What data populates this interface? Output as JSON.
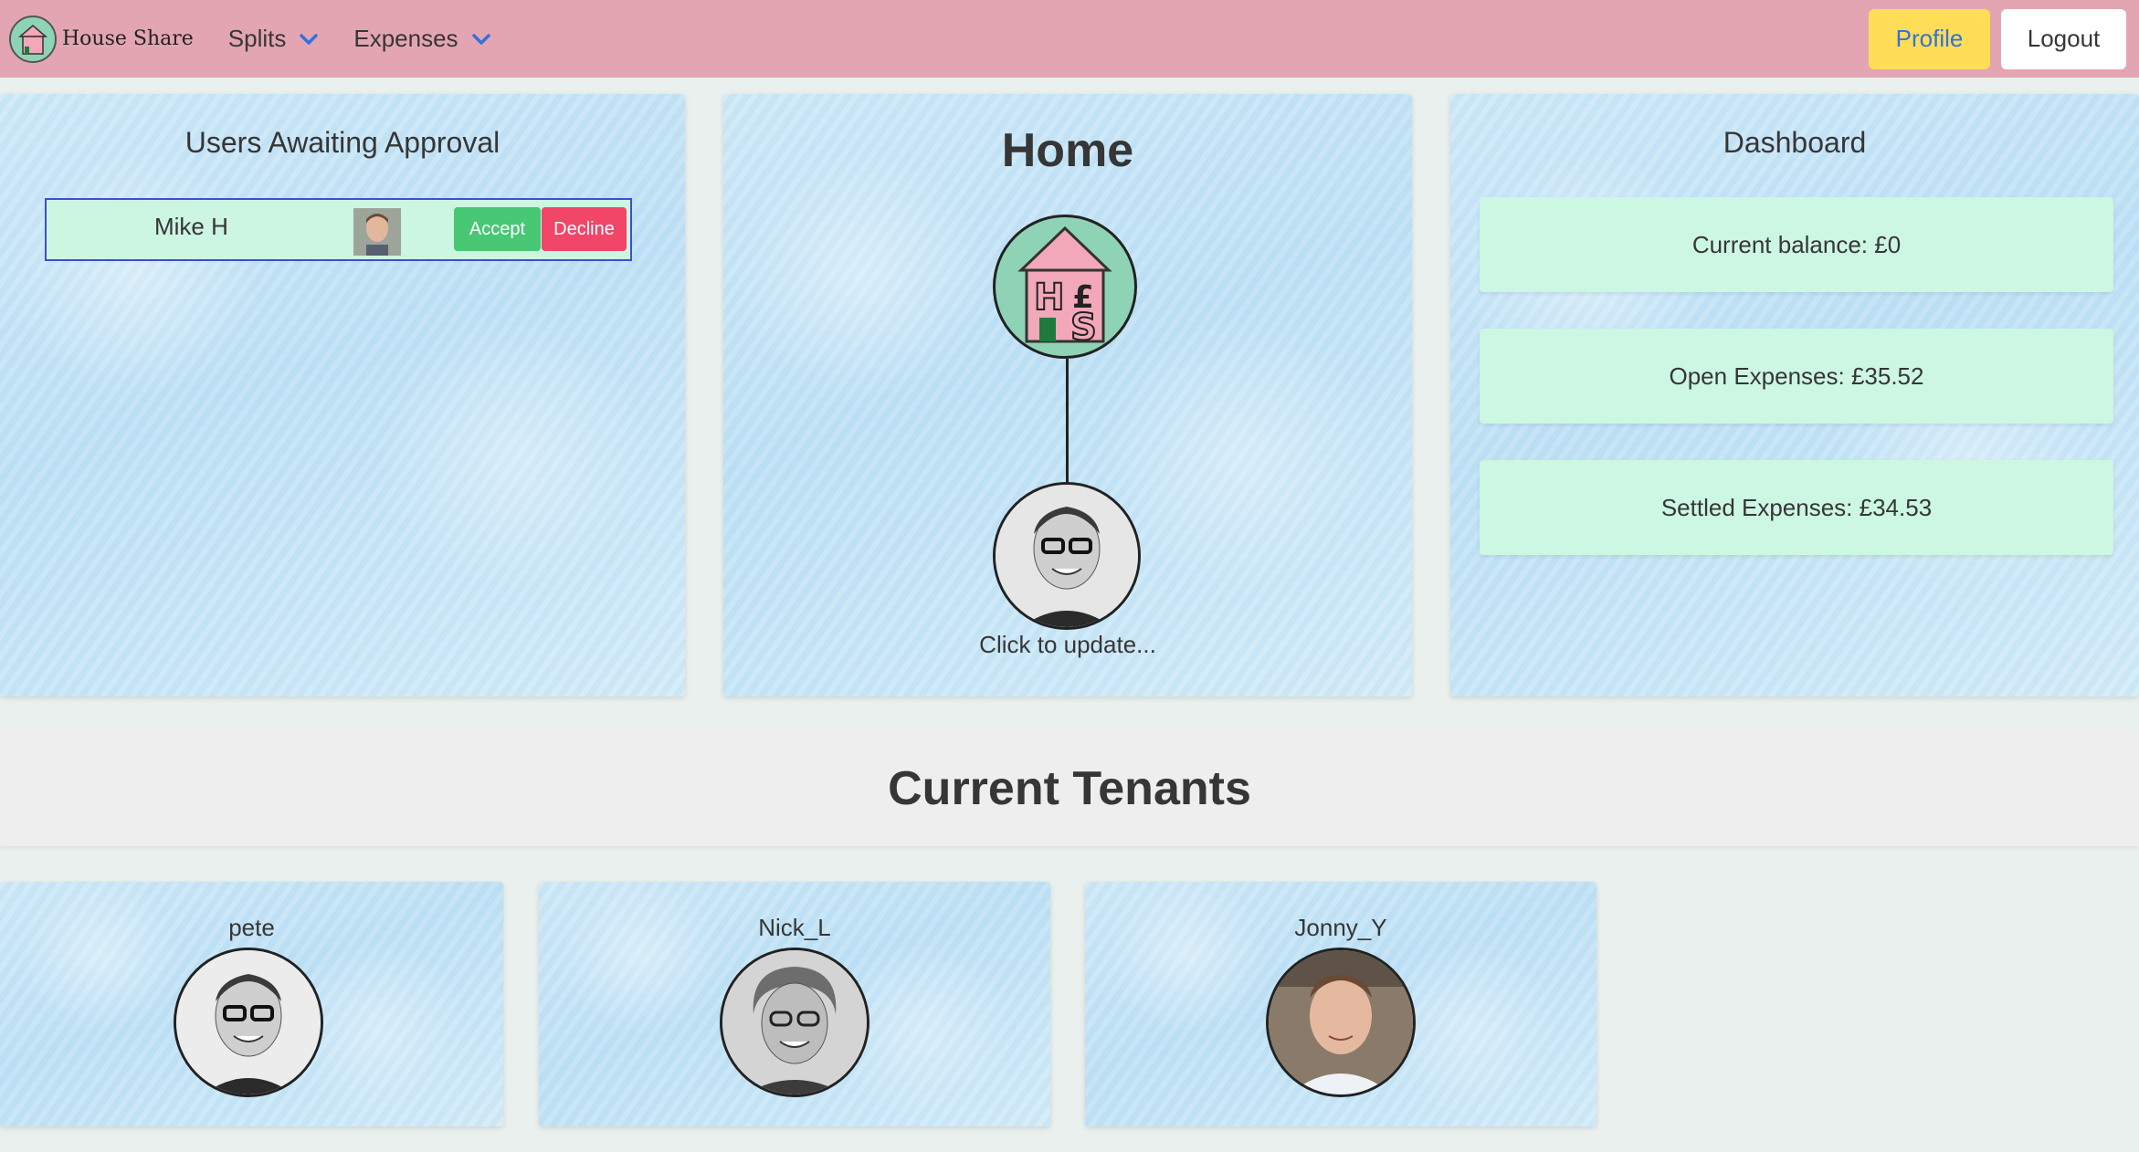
{
  "navbar": {
    "brand": "House Share",
    "menu": [
      {
        "label": "Splits"
      },
      {
        "label": "Expenses"
      }
    ],
    "profile_label": "Profile",
    "logout_label": "Logout"
  },
  "approval": {
    "title": "Users Awaiting Approval",
    "pending": [
      {
        "name": "Mike H",
        "accept_label": "Accept",
        "decline_label": "Decline"
      }
    ]
  },
  "home": {
    "title": "Home",
    "logo_letters": [
      "H",
      "£",
      "S"
    ],
    "update_prompt": "Click to update..."
  },
  "dashboard": {
    "title": "Dashboard",
    "stats": [
      "Current balance: £0",
      "Open Expenses: £35.52",
      "Settled Expenses: £34.53"
    ]
  },
  "tenants": {
    "title": "Current Tenants",
    "list": [
      {
        "name": "pete"
      },
      {
        "name": "Nick_L"
      },
      {
        "name": "Jonny_Y"
      }
    ]
  },
  "colors": {
    "navbar": "#e4a5b2",
    "profile_button": "#ffdd57",
    "accept": "#48c774",
    "decline": "#f14668",
    "mint": "#ccf7e3",
    "logo_green": "#8fd3b7",
    "logo_pink": "#f2a8b8"
  }
}
